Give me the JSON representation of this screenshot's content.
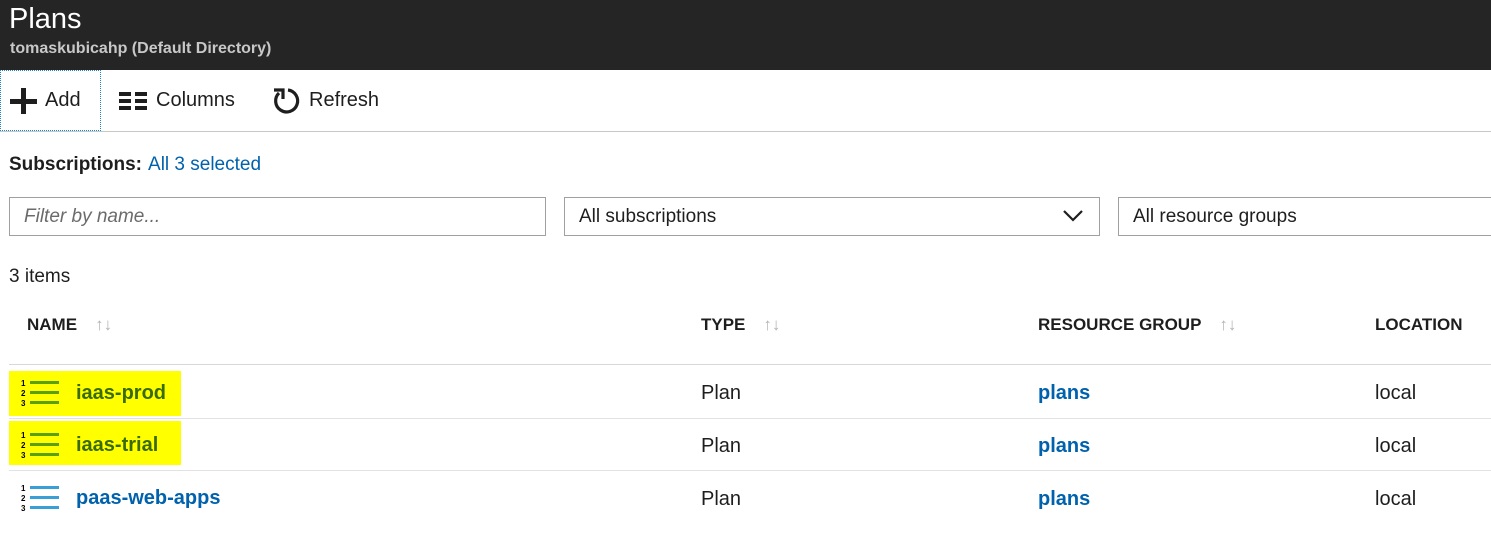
{
  "header": {
    "title": "Plans",
    "subtitle": "tomaskubicahp (Default Directory)"
  },
  "toolbar": {
    "add_label": "Add",
    "columns_label": "Columns",
    "refresh_label": "Refresh"
  },
  "filters": {
    "subscriptions_label": "Subscriptions:",
    "subscriptions_value": "All 3 selected",
    "name_placeholder": "Filter by name...",
    "subscription_select": "All subscriptions",
    "resource_group_select": "All resource groups"
  },
  "items_count": "3 items",
  "table": {
    "columns": [
      "NAME",
      "TYPE",
      "RESOURCE GROUP",
      "LOCATION"
    ],
    "sort_glyph": "↑↓",
    "rows": [
      {
        "name": "iaas-prod",
        "type": "Plan",
        "resource_group": "plans",
        "location": "local",
        "highlighted": true
      },
      {
        "name": "iaas-trial",
        "type": "Plan",
        "resource_group": "plans",
        "location": "local",
        "highlighted": true
      },
      {
        "name": "paas-web-apps",
        "type": "Plan",
        "resource_group": "plans",
        "location": "local",
        "highlighted": false
      }
    ]
  },
  "colors": {
    "header_bg": "#252525",
    "link": "#0062ad",
    "highlight": "#ffff00",
    "icon_green": "#5aa00c",
    "icon_blue": "#3a9fd6"
  },
  "icons": {
    "add": "plus-icon",
    "columns": "columns-icon",
    "refresh": "refresh-icon",
    "dropdown": "chevron-down-icon",
    "plan": "numbered-list-icon"
  }
}
